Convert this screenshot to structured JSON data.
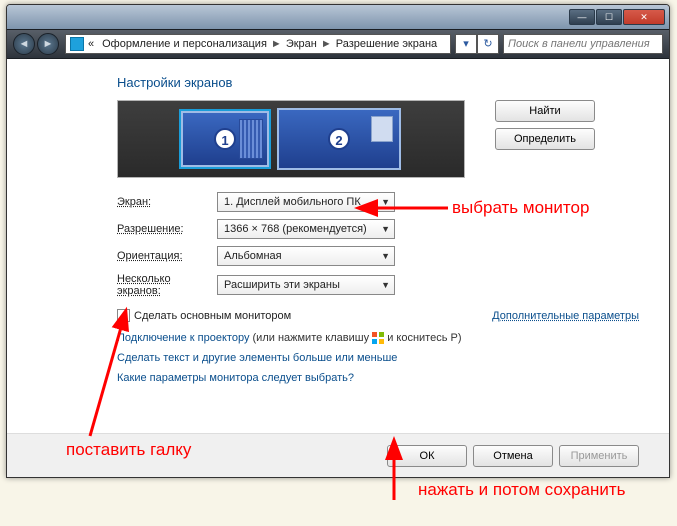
{
  "titlebar": {
    "min": "—",
    "max": "☐",
    "close": "✕"
  },
  "nav": {
    "back": "◄",
    "fwd": "►",
    "crumb0": "«",
    "crumb1": "Оформление и персонализация",
    "crumb2": "Экран",
    "crumb3": "Разрешение экрана",
    "sep": "►",
    "refresh": "↻",
    "search_placeholder": "Поиск в панели управления"
  },
  "page": {
    "title": "Настройки экранов",
    "find_btn": "Найти",
    "detect_btn": "Определить",
    "mon1": "1",
    "mon2": "2"
  },
  "form": {
    "screen_label": "Экран:",
    "screen_value": "1. Дисплей мобильного ПК",
    "res_label": "Разрешение:",
    "res_value": "1366 × 768 (рекомендуется)",
    "orient_label": "Ориентация:",
    "orient_value": "Альбомная",
    "multi_label": "Несколько экранов:",
    "multi_value": "Расширить эти экраны"
  },
  "checkbox": {
    "label": "Сделать основным монитором",
    "extra": "Дополнительные параметры"
  },
  "links": {
    "proj1": "Подключение к проектору",
    "proj2": "(или нажмите клавишу",
    "proj3": "и коснитесь P)",
    "text": "Сделать текст и другие элементы больше или меньше",
    "which": "Какие параметры монитора следует выбрать?"
  },
  "footer": {
    "ok": "ОК",
    "cancel": "Отмена",
    "apply": "Применить"
  },
  "annotations": {
    "select_monitor": "выбрать монитор",
    "set_check": "поставить галку",
    "press_save": "нажать и потом сохранить"
  }
}
